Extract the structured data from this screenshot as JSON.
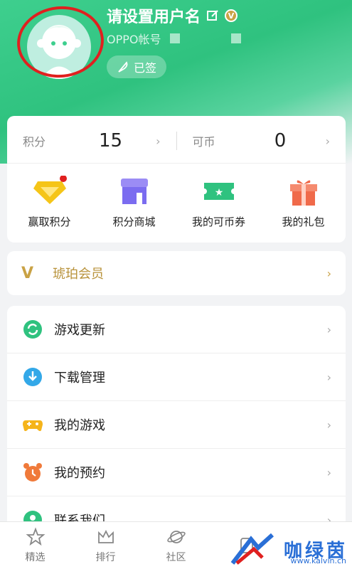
{
  "profile": {
    "username": "请设置用户名",
    "vip_badge": "V",
    "account_label": "OPPO帐号",
    "signed_label": "已签"
  },
  "points": {
    "score_label": "积分",
    "score_value": "15",
    "coin_label": "可币",
    "coin_value": "0"
  },
  "quick_actions": [
    {
      "label": "赢取积分",
      "icon": "diamond-icon",
      "color": "#f5c518"
    },
    {
      "label": "积分商城",
      "icon": "store-icon",
      "color": "#7b6cf0"
    },
    {
      "label": "我的可币券",
      "icon": "ticket-icon",
      "color": "#2fc27f"
    },
    {
      "label": "我的礼包",
      "icon": "gift-icon",
      "color": "#f06a4a"
    }
  ],
  "amber": {
    "label": "琥珀会员",
    "mark": "V"
  },
  "menu": [
    {
      "label": "游戏更新",
      "icon": "refresh-icon"
    },
    {
      "label": "下载管理",
      "icon": "download-icon"
    },
    {
      "label": "我的游戏",
      "icon": "gamepad-icon"
    },
    {
      "label": "我的预约",
      "icon": "alarm-clock-icon"
    },
    {
      "label": "联系我们",
      "icon": "contact-icon"
    }
  ],
  "tabs": [
    {
      "label": "精选",
      "icon": "star-icon"
    },
    {
      "label": "排行",
      "icon": "crown-icon"
    },
    {
      "label": "社区",
      "icon": "planet-icon"
    }
  ],
  "watermark": {
    "text": "咖绿茵",
    "url": "www.kalvin.cn"
  },
  "colors": {
    "brand": "#2fc27f",
    "amber": "#c9a245",
    "badge_red": "#e0201f"
  }
}
